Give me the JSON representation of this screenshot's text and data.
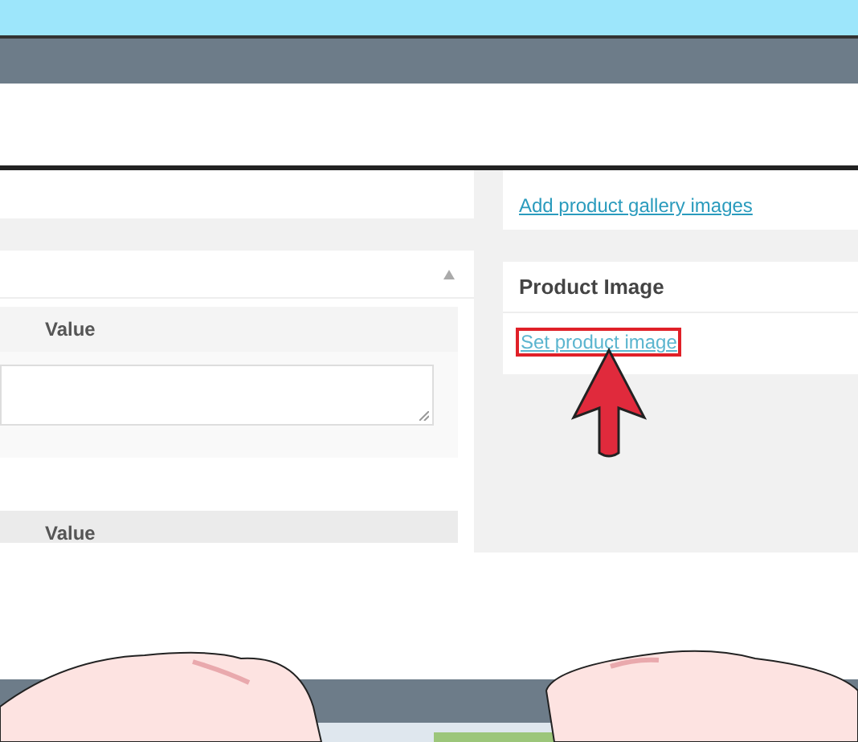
{
  "main_panel": {
    "collapsed": false,
    "tables": [
      {
        "column": "Value"
      },
      {
        "column": "Value"
      }
    ]
  },
  "gallery_box": {
    "link": "Add product gallery images"
  },
  "product_image_box": {
    "title": "Product Image",
    "link": "Set product image",
    "highlighted": true
  }
}
